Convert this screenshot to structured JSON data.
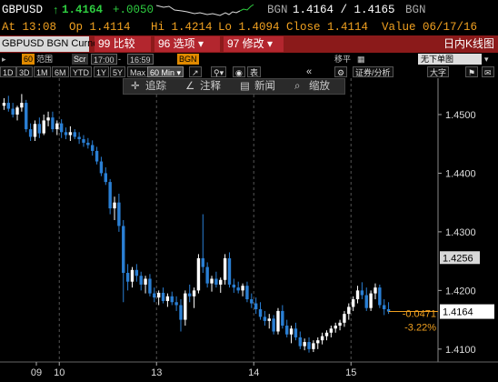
{
  "ticker": {
    "symbol": "GBPUSD",
    "arrow": "↑",
    "last": "1.4164",
    "change": "+.0050",
    "source": "BGN",
    "bid_ask": "1.4164 / 1.4165",
    "source2": "BGN"
  },
  "quote": {
    "at": "At 13:08",
    "open": "Op 1.4114",
    "high": "Hi 1.4214",
    "low": "Lo 1.4094",
    "close": "Close 1.4114",
    "value": "Value 06/17/16"
  },
  "function_bar": {
    "security": "GBPUSD BGN Curncy",
    "tabs": [
      "99 比较",
      "96 选项 ▾",
      "97 修改 ▾"
    ],
    "chart_type": "日内K线图"
  },
  "toolbar": {
    "period_label": "范围",
    "period_num": "60",
    "scr": "Scr",
    "start": "17:00",
    "end": "16:59",
    "bgn": "BGN",
    "move": "移平",
    "no_template": "无下单图",
    "table_label": "表"
  },
  "period_buttons": [
    "1D",
    "3D",
    "1M",
    "6M",
    "YTD",
    "1Y",
    "5Y",
    "Max",
    "60 Min ▾"
  ],
  "period_selected": "60 Min ▾",
  "right_toolbar": {
    "nav": "«",
    "security_analysis": "证券/分析",
    "zoom": "大字"
  },
  "chart_tools": [
    "追踪",
    "注释",
    "新闻",
    "缩放"
  ],
  "colors": {
    "up": "#ffffff",
    "down": "#2a7fd4",
    "accent": "#f0a020",
    "function_bar": "#8b1a1a",
    "tab": "#b3262e"
  },
  "chart_data": {
    "type": "candlestick",
    "title": "",
    "x_tick_labels": [
      "09",
      "10",
      "13",
      "14",
      "15"
    ],
    "y_ticks": [
      1.41,
      1.42,
      1.43,
      1.44,
      1.45
    ],
    "y_tick_labels": [
      "1.4100",
      "1.4200",
      "1.4300",
      "1.4400",
      "1.4500"
    ],
    "ylim": [
      1.4078,
      1.4562
    ],
    "last_price": 1.4164,
    "marker_price": 1.4256,
    "change_abs": "-0.0471",
    "change_pct": "-3.22%",
    "grid": "vertical dashed at day boundaries",
    "candles": [
      [
        1.4515,
        1.4528,
        1.4508,
        1.452
      ],
      [
        1.452,
        1.4532,
        1.4505,
        1.451
      ],
      [
        1.451,
        1.452,
        1.4495,
        1.45
      ],
      [
        1.45,
        1.4515,
        1.449,
        1.4512
      ],
      [
        1.4512,
        1.4535,
        1.4505,
        1.452
      ],
      [
        1.452,
        1.4525,
        1.447,
        1.4475
      ],
      [
        1.4475,
        1.4485,
        1.4455,
        1.4462
      ],
      [
        1.4462,
        1.449,
        1.4455,
        1.4484
      ],
      [
        1.4484,
        1.4495,
        1.446,
        1.4468
      ],
      [
        1.4468,
        1.45,
        1.4465,
        1.449
      ],
      [
        1.449,
        1.4505,
        1.448,
        1.4495
      ],
      [
        1.4495,
        1.4505,
        1.447,
        1.4475
      ],
      [
        1.4475,
        1.449,
        1.4465,
        1.4485
      ],
      [
        1.4485,
        1.4492,
        1.446,
        1.447
      ],
      [
        1.447,
        1.4478,
        1.4458,
        1.4465
      ],
      [
        1.4465,
        1.448,
        1.4455,
        1.447
      ],
      [
        1.447,
        1.4475,
        1.4458,
        1.4462
      ],
      [
        1.4462,
        1.447,
        1.445,
        1.4458
      ],
      [
        1.4458,
        1.4465,
        1.4445,
        1.4452
      ],
      [
        1.4452,
        1.446,
        1.4442,
        1.4448
      ],
      [
        1.4448,
        1.4456,
        1.443,
        1.4438
      ],
      [
        1.4438,
        1.4445,
        1.4415,
        1.442
      ],
      [
        1.442,
        1.4428,
        1.4395,
        1.44
      ],
      [
        1.44,
        1.441,
        1.438,
        1.4385
      ],
      [
        1.4385,
        1.439,
        1.433,
        1.434
      ],
      [
        1.434,
        1.436,
        1.432,
        1.435
      ],
      [
        1.435,
        1.4365,
        1.43,
        1.431
      ],
      [
        1.431,
        1.432,
        1.418,
        1.423
      ],
      [
        1.423,
        1.4245,
        1.42,
        1.4215
      ],
      [
        1.4215,
        1.424,
        1.4205,
        1.4235
      ],
      [
        1.4235,
        1.4245,
        1.4215,
        1.4225
      ],
      [
        1.4225,
        1.4232,
        1.42,
        1.421
      ],
      [
        1.421,
        1.4225,
        1.4195,
        1.422
      ],
      [
        1.422,
        1.4228,
        1.419,
        1.4195
      ],
      [
        1.4195,
        1.4205,
        1.418,
        1.4188
      ],
      [
        1.4188,
        1.42,
        1.4175,
        1.4196
      ],
      [
        1.4196,
        1.4205,
        1.4178,
        1.4182
      ],
      [
        1.4182,
        1.4195,
        1.4172,
        1.419
      ],
      [
        1.419,
        1.4198,
        1.4175,
        1.418
      ],
      [
        1.418,
        1.419,
        1.4165,
        1.4175
      ],
      [
        1.4175,
        1.4185,
        1.413,
        1.415
      ],
      [
        1.415,
        1.42,
        1.414,
        1.4195
      ],
      [
        1.4195,
        1.421,
        1.418,
        1.419
      ],
      [
        1.419,
        1.4205,
        1.417,
        1.42
      ],
      [
        1.42,
        1.4262,
        1.4195,
        1.4255
      ],
      [
        1.4255,
        1.433,
        1.423,
        1.424
      ],
      [
        1.424,
        1.4248,
        1.4205,
        1.4212
      ],
      [
        1.4212,
        1.4225,
        1.4198,
        1.422
      ],
      [
        1.422,
        1.4232,
        1.4205,
        1.421
      ],
      [
        1.421,
        1.4222,
        1.4196,
        1.4218
      ],
      [
        1.4218,
        1.4262,
        1.421,
        1.4255
      ],
      [
        1.4255,
        1.4265,
        1.4205,
        1.421
      ],
      [
        1.421,
        1.422,
        1.4196,
        1.4205
      ],
      [
        1.4205,
        1.4215,
        1.4195,
        1.42
      ],
      [
        1.42,
        1.4212,
        1.419,
        1.4208
      ],
      [
        1.4208,
        1.4215,
        1.418,
        1.4185
      ],
      [
        1.4185,
        1.4195,
        1.417,
        1.4178
      ],
      [
        1.4178,
        1.4188,
        1.416,
        1.4168
      ],
      [
        1.4168,
        1.418,
        1.415,
        1.4155
      ],
      [
        1.4155,
        1.4165,
        1.414,
        1.4148
      ],
      [
        1.4148,
        1.416,
        1.4135,
        1.4152
      ],
      [
        1.4152,
        1.4158,
        1.4125,
        1.413
      ],
      [
        1.413,
        1.417,
        1.4125,
        1.4165
      ],
      [
        1.4165,
        1.4175,
        1.4135,
        1.414
      ],
      [
        1.414,
        1.415,
        1.412,
        1.4125
      ],
      [
        1.4125,
        1.414,
        1.411,
        1.4135
      ],
      [
        1.4135,
        1.4145,
        1.4115,
        1.412
      ],
      [
        1.412,
        1.413,
        1.41,
        1.4105
      ],
      [
        1.4105,
        1.4118,
        1.4098,
        1.4112
      ],
      [
        1.4112,
        1.412,
        1.4094,
        1.41
      ],
      [
        1.41,
        1.4115,
        1.4095,
        1.411
      ],
      [
        1.411,
        1.412,
        1.41,
        1.4115
      ],
      [
        1.4115,
        1.4128,
        1.4108,
        1.4122
      ],
      [
        1.4122,
        1.4132,
        1.4115,
        1.4128
      ],
      [
        1.4128,
        1.414,
        1.412,
        1.4135
      ],
      [
        1.4135,
        1.4145,
        1.4128,
        1.414
      ],
      [
        1.414,
        1.415,
        1.4132,
        1.4145
      ],
      [
        1.4145,
        1.4165,
        1.4138,
        1.416
      ],
      [
        1.416,
        1.4178,
        1.415,
        1.4172
      ],
      [
        1.4172,
        1.419,
        1.4165,
        1.4185
      ],
      [
        1.4185,
        1.4208,
        1.4178,
        1.42
      ],
      [
        1.42,
        1.4214,
        1.4185,
        1.4192
      ],
      [
        1.4192,
        1.4205,
        1.4165,
        1.417
      ],
      [
        1.417,
        1.42,
        1.4165,
        1.4195
      ],
      [
        1.4195,
        1.4212,
        1.4185,
        1.4205
      ],
      [
        1.4205,
        1.421,
        1.417,
        1.4175
      ],
      [
        1.4175,
        1.4185,
        1.4158,
        1.4168
      ],
      [
        1.4168,
        1.418,
        1.416,
        1.4164
      ]
    ]
  }
}
